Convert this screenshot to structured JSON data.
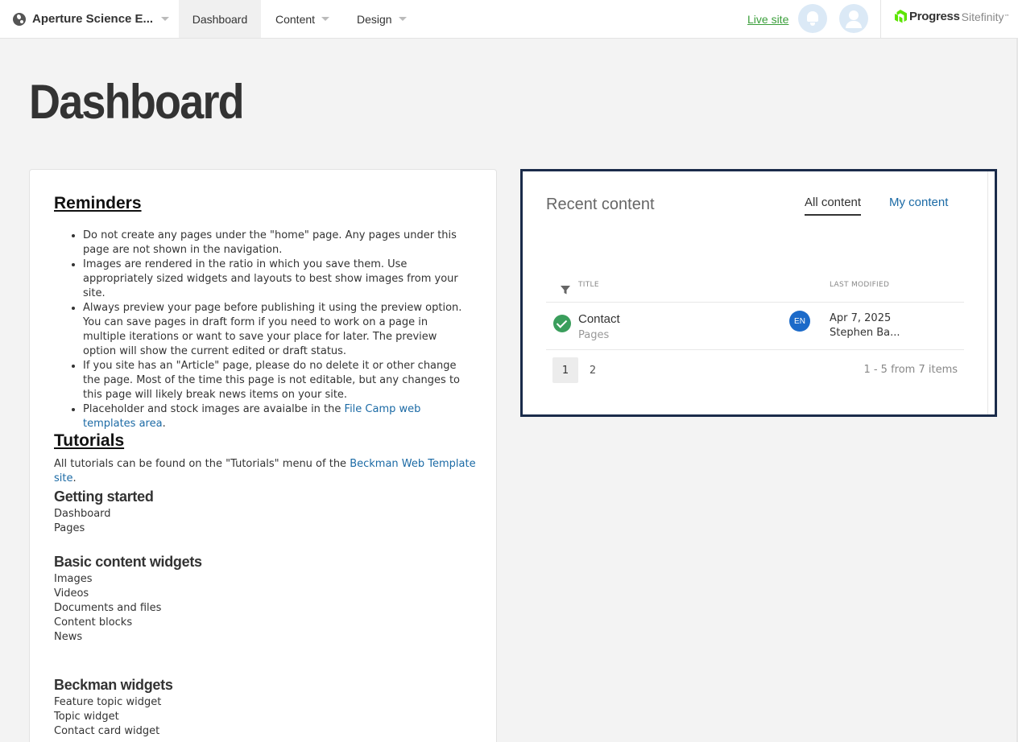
{
  "topbar": {
    "site_name": "Aperture Science E...",
    "nav": {
      "dashboard": "Dashboard",
      "content": "Content",
      "design": "Design"
    },
    "live_site": "Live site",
    "brand": {
      "progress": "Progress",
      "sitefinity": "Sitefinity",
      "tm": "™",
      "colors": {
        "mark": "#5ce500"
      }
    }
  },
  "page_title": "Dashboard",
  "reminders": {
    "heading": "Reminders",
    "items": [
      "Do not create any pages under the \"home\" page. Any pages under this page are not shown in the navigation.",
      "Images are rendered in the ratio in which you save them. Use appropriately sized widgets and layouts to best show images from your site.",
      "Always preview your page before publishing it using the preview option. You can save pages in draft form if you need to work on a page in multiple iterations or want to save your place for later. The preview option will show the current edited or draft status.",
      "If you site has an \"Article\" page, please do no delete it or other change the page. Most of the time this page is not editable, but any changes to this page will likely break news items on your site."
    ],
    "last_item_prefix": "Placeholder and stock images are avaialbe in the ",
    "last_item_link": "File Camp web templates area",
    "last_item_suffix": "."
  },
  "tutorials": {
    "heading": "Tutorials",
    "intro_prefix": "All tutorials can be found on the \"Tutorials\" menu of the ",
    "intro_link": "Beckman Web Template site",
    "intro_suffix": ".",
    "getting_started": {
      "heading": "Getting started",
      "items": [
        "Dashboard",
        "Pages"
      ]
    },
    "basic_widgets": {
      "heading": "Basic content widgets",
      "items": [
        "Images",
        "Videos",
        "Documents and files",
        "Content blocks",
        "News"
      ]
    },
    "beckman_widgets": {
      "heading": "Beckman widgets",
      "items": [
        "Feature topic widget",
        "Topic widget",
        "Contact card widget"
      ]
    }
  },
  "recent_content": {
    "title": "Recent content",
    "tabs": {
      "all": "All content",
      "mine": "My content"
    },
    "columns": {
      "title": "TITLE",
      "last_modified": "LAST MODIFIED"
    },
    "rows": [
      {
        "title": "Contact",
        "type": "Pages",
        "language": "EN",
        "date": "Apr 7, 2025",
        "author": "Stephen Ba...",
        "status": "published"
      }
    ],
    "pager": {
      "pages": [
        "1",
        "2"
      ],
      "current": "1",
      "info": "1 - 5 from 7 items"
    }
  },
  "colors": {
    "accent_link": "#1b6aa5",
    "live_site": "#3a9e3a",
    "status_ok": "#3a9e5c",
    "lang_badge": "#1b6ac9",
    "panel_border": "#1a2b4a"
  }
}
